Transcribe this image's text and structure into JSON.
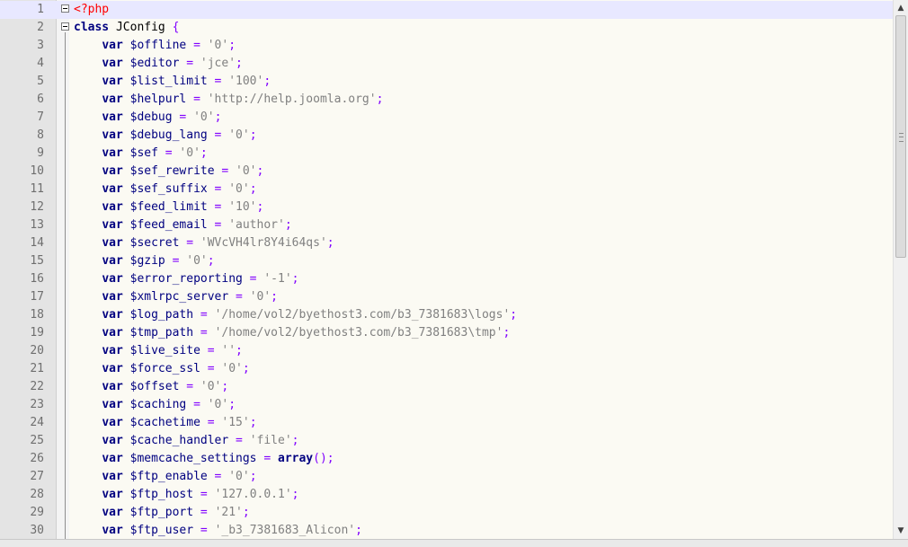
{
  "editor": {
    "language": "php",
    "current_line": 1,
    "lines": [
      {
        "n": "1",
        "t": [
          {
            "c": "phptag",
            "s": "<?php"
          }
        ],
        "fold": true
      },
      {
        "n": "2",
        "t": [
          {
            "c": "kw",
            "s": "class"
          },
          {
            "c": "p",
            "s": " JConfig "
          },
          {
            "c": "op",
            "s": "{"
          }
        ],
        "fold": true
      },
      {
        "n": "3",
        "t": [
          {
            "c": "p",
            "s": "    "
          },
          {
            "c": "kw",
            "s": "var"
          },
          {
            "c": "var",
            "s": " $offline"
          },
          {
            "c": "op",
            "s": " = "
          },
          {
            "c": "str",
            "s": "'0'"
          },
          {
            "c": "op",
            "s": ";"
          }
        ]
      },
      {
        "n": "4",
        "t": [
          {
            "c": "p",
            "s": "    "
          },
          {
            "c": "kw",
            "s": "var"
          },
          {
            "c": "var",
            "s": " $editor"
          },
          {
            "c": "op",
            "s": " = "
          },
          {
            "c": "str",
            "s": "'jce'"
          },
          {
            "c": "op",
            "s": ";"
          }
        ]
      },
      {
        "n": "5",
        "t": [
          {
            "c": "p",
            "s": "    "
          },
          {
            "c": "kw",
            "s": "var"
          },
          {
            "c": "var",
            "s": " $list_limit"
          },
          {
            "c": "op",
            "s": " = "
          },
          {
            "c": "str",
            "s": "'100'"
          },
          {
            "c": "op",
            "s": ";"
          }
        ]
      },
      {
        "n": "6",
        "t": [
          {
            "c": "p",
            "s": "    "
          },
          {
            "c": "kw",
            "s": "var"
          },
          {
            "c": "var",
            "s": " $helpurl"
          },
          {
            "c": "op",
            "s": " = "
          },
          {
            "c": "str",
            "s": "'http://help.joomla.org'"
          },
          {
            "c": "op",
            "s": ";"
          }
        ]
      },
      {
        "n": "7",
        "t": [
          {
            "c": "p",
            "s": "    "
          },
          {
            "c": "kw",
            "s": "var"
          },
          {
            "c": "var",
            "s": " $debug"
          },
          {
            "c": "op",
            "s": " = "
          },
          {
            "c": "str",
            "s": "'0'"
          },
          {
            "c": "op",
            "s": ";"
          }
        ]
      },
      {
        "n": "8",
        "t": [
          {
            "c": "p",
            "s": "    "
          },
          {
            "c": "kw",
            "s": "var"
          },
          {
            "c": "var",
            "s": " $debug_lang"
          },
          {
            "c": "op",
            "s": " = "
          },
          {
            "c": "str",
            "s": "'0'"
          },
          {
            "c": "op",
            "s": ";"
          }
        ]
      },
      {
        "n": "9",
        "t": [
          {
            "c": "p",
            "s": "    "
          },
          {
            "c": "kw",
            "s": "var"
          },
          {
            "c": "var",
            "s": " $sef"
          },
          {
            "c": "op",
            "s": " = "
          },
          {
            "c": "str",
            "s": "'0'"
          },
          {
            "c": "op",
            "s": ";"
          }
        ]
      },
      {
        "n": "10",
        "t": [
          {
            "c": "p",
            "s": "    "
          },
          {
            "c": "kw",
            "s": "var"
          },
          {
            "c": "var",
            "s": " $sef_rewrite"
          },
          {
            "c": "op",
            "s": " = "
          },
          {
            "c": "str",
            "s": "'0'"
          },
          {
            "c": "op",
            "s": ";"
          }
        ]
      },
      {
        "n": "11",
        "t": [
          {
            "c": "p",
            "s": "    "
          },
          {
            "c": "kw",
            "s": "var"
          },
          {
            "c": "var",
            "s": " $sef_suffix"
          },
          {
            "c": "op",
            "s": " = "
          },
          {
            "c": "str",
            "s": "'0'"
          },
          {
            "c": "op",
            "s": ";"
          }
        ]
      },
      {
        "n": "12",
        "t": [
          {
            "c": "p",
            "s": "    "
          },
          {
            "c": "kw",
            "s": "var"
          },
          {
            "c": "var",
            "s": " $feed_limit"
          },
          {
            "c": "op",
            "s": " = "
          },
          {
            "c": "str",
            "s": "'10'"
          },
          {
            "c": "op",
            "s": ";"
          }
        ]
      },
      {
        "n": "13",
        "t": [
          {
            "c": "p",
            "s": "    "
          },
          {
            "c": "kw",
            "s": "var"
          },
          {
            "c": "var",
            "s": " $feed_email"
          },
          {
            "c": "op",
            "s": " = "
          },
          {
            "c": "str",
            "s": "'author'"
          },
          {
            "c": "op",
            "s": ";"
          }
        ]
      },
      {
        "n": "14",
        "t": [
          {
            "c": "p",
            "s": "    "
          },
          {
            "c": "kw",
            "s": "var"
          },
          {
            "c": "var",
            "s": " $secret"
          },
          {
            "c": "op",
            "s": " = "
          },
          {
            "c": "str",
            "s": "'WVcVH4lr8Y4i64qs'"
          },
          {
            "c": "op",
            "s": ";"
          }
        ]
      },
      {
        "n": "15",
        "t": [
          {
            "c": "p",
            "s": "    "
          },
          {
            "c": "kw",
            "s": "var"
          },
          {
            "c": "var",
            "s": " $gzip"
          },
          {
            "c": "op",
            "s": " = "
          },
          {
            "c": "str",
            "s": "'0'"
          },
          {
            "c": "op",
            "s": ";"
          }
        ]
      },
      {
        "n": "16",
        "t": [
          {
            "c": "p",
            "s": "    "
          },
          {
            "c": "kw",
            "s": "var"
          },
          {
            "c": "var",
            "s": " $error_reporting"
          },
          {
            "c": "op",
            "s": " = "
          },
          {
            "c": "str",
            "s": "'-1'"
          },
          {
            "c": "op",
            "s": ";"
          }
        ]
      },
      {
        "n": "17",
        "t": [
          {
            "c": "p",
            "s": "    "
          },
          {
            "c": "kw",
            "s": "var"
          },
          {
            "c": "var",
            "s": " $xmlrpc_server"
          },
          {
            "c": "op",
            "s": " = "
          },
          {
            "c": "str",
            "s": "'0'"
          },
          {
            "c": "op",
            "s": ";"
          }
        ]
      },
      {
        "n": "18",
        "t": [
          {
            "c": "p",
            "s": "    "
          },
          {
            "c": "kw",
            "s": "var"
          },
          {
            "c": "var",
            "s": " $log_path"
          },
          {
            "c": "op",
            "s": " = "
          },
          {
            "c": "str",
            "s": "'/home/vol2/byethost3.com/b3_7381683\\logs'"
          },
          {
            "c": "op",
            "s": ";"
          }
        ]
      },
      {
        "n": "19",
        "t": [
          {
            "c": "p",
            "s": "    "
          },
          {
            "c": "kw",
            "s": "var"
          },
          {
            "c": "var",
            "s": " $tmp_path"
          },
          {
            "c": "op",
            "s": " = "
          },
          {
            "c": "str",
            "s": "'/home/vol2/byethost3.com/b3_7381683\\tmp'"
          },
          {
            "c": "op",
            "s": ";"
          }
        ]
      },
      {
        "n": "20",
        "t": [
          {
            "c": "p",
            "s": "    "
          },
          {
            "c": "kw",
            "s": "var"
          },
          {
            "c": "var",
            "s": " $live_site"
          },
          {
            "c": "op",
            "s": " = "
          },
          {
            "c": "str",
            "s": "''"
          },
          {
            "c": "op",
            "s": ";"
          }
        ]
      },
      {
        "n": "21",
        "t": [
          {
            "c": "p",
            "s": "    "
          },
          {
            "c": "kw",
            "s": "var"
          },
          {
            "c": "var",
            "s": " $force_ssl"
          },
          {
            "c": "op",
            "s": " = "
          },
          {
            "c": "str",
            "s": "'0'"
          },
          {
            "c": "op",
            "s": ";"
          }
        ]
      },
      {
        "n": "22",
        "t": [
          {
            "c": "p",
            "s": "    "
          },
          {
            "c": "kw",
            "s": "var"
          },
          {
            "c": "var",
            "s": " $offset"
          },
          {
            "c": "op",
            "s": " = "
          },
          {
            "c": "str",
            "s": "'0'"
          },
          {
            "c": "op",
            "s": ";"
          }
        ]
      },
      {
        "n": "23",
        "t": [
          {
            "c": "p",
            "s": "    "
          },
          {
            "c": "kw",
            "s": "var"
          },
          {
            "c": "var",
            "s": " $caching"
          },
          {
            "c": "op",
            "s": " = "
          },
          {
            "c": "str",
            "s": "'0'"
          },
          {
            "c": "op",
            "s": ";"
          }
        ]
      },
      {
        "n": "24",
        "t": [
          {
            "c": "p",
            "s": "    "
          },
          {
            "c": "kw",
            "s": "var"
          },
          {
            "c": "var",
            "s": " $cachetime"
          },
          {
            "c": "op",
            "s": " = "
          },
          {
            "c": "str",
            "s": "'15'"
          },
          {
            "c": "op",
            "s": ";"
          }
        ]
      },
      {
        "n": "25",
        "t": [
          {
            "c": "p",
            "s": "    "
          },
          {
            "c": "kw",
            "s": "var"
          },
          {
            "c": "var",
            "s": " $cache_handler"
          },
          {
            "c": "op",
            "s": " = "
          },
          {
            "c": "str",
            "s": "'file'"
          },
          {
            "c": "op",
            "s": ";"
          }
        ]
      },
      {
        "n": "26",
        "t": [
          {
            "c": "p",
            "s": "    "
          },
          {
            "c": "kw",
            "s": "var"
          },
          {
            "c": "var",
            "s": " $memcache_settings"
          },
          {
            "c": "op",
            "s": " = "
          },
          {
            "c": "kw",
            "s": "array"
          },
          {
            "c": "op",
            "s": "();"
          }
        ]
      },
      {
        "n": "27",
        "t": [
          {
            "c": "p",
            "s": "    "
          },
          {
            "c": "kw",
            "s": "var"
          },
          {
            "c": "var",
            "s": " $ftp_enable"
          },
          {
            "c": "op",
            "s": " = "
          },
          {
            "c": "str",
            "s": "'0'"
          },
          {
            "c": "op",
            "s": ";"
          }
        ]
      },
      {
        "n": "28",
        "t": [
          {
            "c": "p",
            "s": "    "
          },
          {
            "c": "kw",
            "s": "var"
          },
          {
            "c": "var",
            "s": " $ftp_host"
          },
          {
            "c": "op",
            "s": " = "
          },
          {
            "c": "str",
            "s": "'127.0.0.1'"
          },
          {
            "c": "op",
            "s": ";"
          }
        ]
      },
      {
        "n": "29",
        "t": [
          {
            "c": "p",
            "s": "    "
          },
          {
            "c": "kw",
            "s": "var"
          },
          {
            "c": "var",
            "s": " $ftp_port"
          },
          {
            "c": "op",
            "s": " = "
          },
          {
            "c": "str",
            "s": "'21'"
          },
          {
            "c": "op",
            "s": ";"
          }
        ]
      },
      {
        "n": "30",
        "t": [
          {
            "c": "p",
            "s": "    "
          },
          {
            "c": "kw",
            "s": "var"
          },
          {
            "c": "var",
            "s": " $ftp_user"
          },
          {
            "c": "op",
            "s": " = "
          },
          {
            "c": "str",
            "s": "'_b3_7381683_Alicon'"
          },
          {
            "c": "op",
            "s": ";"
          }
        ]
      }
    ]
  },
  "scrollbar": {
    "up_icon": "arrow-up-icon",
    "down_icon": "arrow-down-icon",
    "up_glyph": "▲",
    "down_glyph": "▼"
  },
  "colors": {
    "background": "#fbfaf3",
    "gutter": "#e4e4e4",
    "current_line": "#e8e8ff",
    "keyword": "#000080",
    "string": "#808080",
    "operator": "#8000ff",
    "php_tag": "#ff0000"
  }
}
